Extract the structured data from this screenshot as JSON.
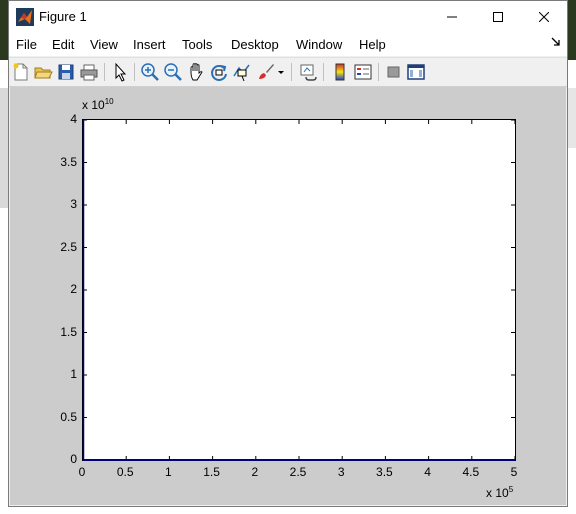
{
  "window": {
    "title": "Figure 1",
    "controls": {
      "minimize": "—",
      "maximize": "☐",
      "close": "✕"
    }
  },
  "menu": {
    "items": [
      {
        "label": "File"
      },
      {
        "label": "Edit"
      },
      {
        "label": "View"
      },
      {
        "label": "Insert"
      },
      {
        "label": "Tools"
      },
      {
        "label": "Desktop"
      },
      {
        "label": "Window"
      },
      {
        "label": "Help"
      }
    ],
    "overflow_icon": "dock-arrow-icon"
  },
  "toolbar": {
    "icons": [
      "new-figure-icon",
      "open-file-icon",
      "save-icon",
      "print-icon",
      "edit-plot-icon",
      "zoom-in-icon",
      "zoom-out-icon",
      "pan-icon",
      "rotate-3d-icon",
      "data-cursor-icon",
      "brush-icon",
      "dropdown-arrow-icon",
      "link-plot-icon",
      "insert-colorbar-icon",
      "insert-legend-icon",
      "hide-plot-tools-icon",
      "show-plot-tools-icon"
    ]
  },
  "chart_data": {
    "type": "line",
    "x": [
      0,
      500000
    ],
    "series": [
      {
        "values": [
          0,
          0
        ]
      }
    ],
    "xlim": [
      0,
      500000
    ],
    "ylim": [
      0,
      40000000000
    ],
    "x_ticks": [
      "0",
      "0.5",
      "1",
      "1.5",
      "2",
      "2.5",
      "3",
      "3.5",
      "4",
      "4.5",
      "5"
    ],
    "y_ticks": [
      "0",
      "0.5",
      "1",
      "1.5",
      "2",
      "2.5",
      "3",
      "3.5",
      "4"
    ],
    "x_exponent": {
      "base": "x 10",
      "power": "5"
    },
    "y_exponent": {
      "base": "x 10",
      "power": "10"
    },
    "line_color": "#00007f",
    "grid": false
  }
}
